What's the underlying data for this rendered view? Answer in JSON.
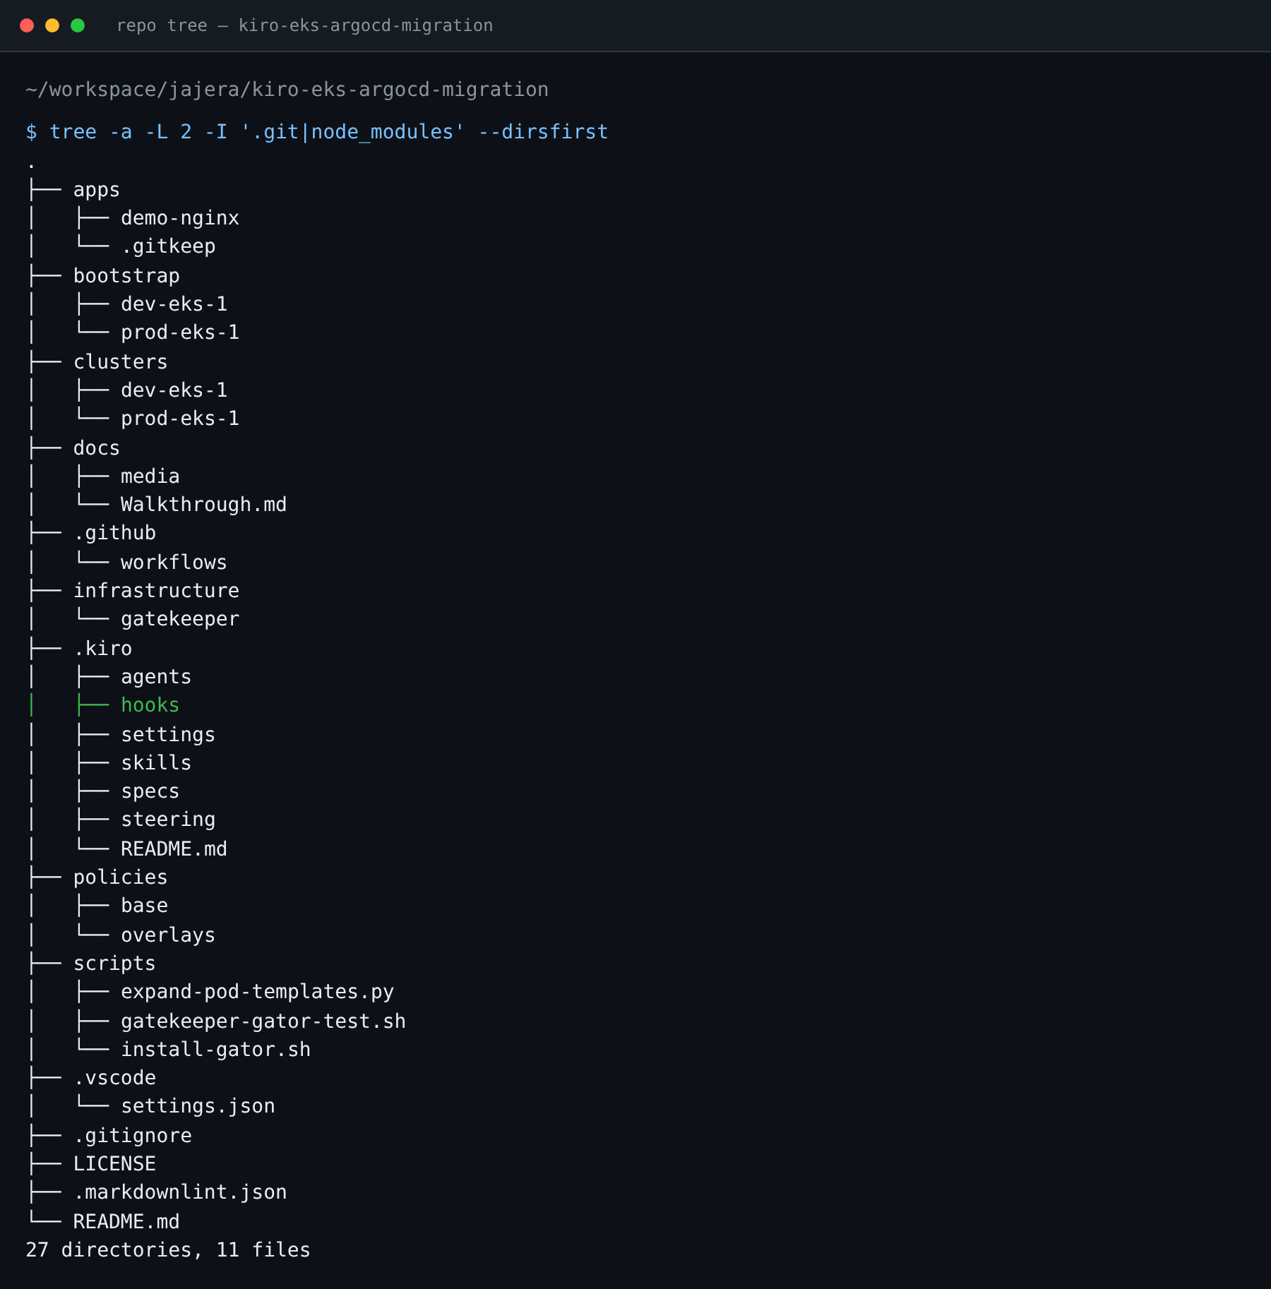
{
  "window": {
    "title": "repo tree — kiro-eks-argocd-migration"
  },
  "terminal": {
    "cwd": "~/workspace/jajera/kiro-eks-argocd-migration",
    "command": "$ tree -a -L 2 -I '.git|node_modules' --dirsfirst",
    "root": ".",
    "tree": [
      {
        "branch": "├── ",
        "name": "apps",
        "selected": false,
        "children": [
          {
            "branch": "│   ├── ",
            "name": "demo-nginx",
            "selected": false
          },
          {
            "branch": "│   └── ",
            "name": ".gitkeep",
            "selected": false
          }
        ]
      },
      {
        "branch": "├── ",
        "name": "bootstrap",
        "selected": false,
        "children": [
          {
            "branch": "│   ├── ",
            "name": "dev-eks-1",
            "selected": false
          },
          {
            "branch": "│   └── ",
            "name": "prod-eks-1",
            "selected": false
          }
        ]
      },
      {
        "branch": "├── ",
        "name": "clusters",
        "selected": false,
        "children": [
          {
            "branch": "│   ├── ",
            "name": "dev-eks-1",
            "selected": false
          },
          {
            "branch": "│   └── ",
            "name": "prod-eks-1",
            "selected": false
          }
        ]
      },
      {
        "branch": "├── ",
        "name": "docs",
        "selected": false,
        "children": [
          {
            "branch": "│   ├── ",
            "name": "media",
            "selected": false
          },
          {
            "branch": "│   └── ",
            "name": "Walkthrough.md",
            "selected": false
          }
        ]
      },
      {
        "branch": "├── ",
        "name": ".github",
        "selected": false,
        "children": [
          {
            "branch": "│   └── ",
            "name": "workflows",
            "selected": false
          }
        ]
      },
      {
        "branch": "├── ",
        "name": "infrastructure",
        "selected": false,
        "children": [
          {
            "branch": "│   └── ",
            "name": "gatekeeper",
            "selected": false
          }
        ]
      },
      {
        "branch": "├── ",
        "name": ".kiro",
        "selected": false,
        "children": [
          {
            "branch": "│   ├── ",
            "name": "agents",
            "selected": false
          },
          {
            "branch": "│   ├── ",
            "name": "hooks",
            "selected": true
          },
          {
            "branch": "│   ├── ",
            "name": "settings",
            "selected": false
          },
          {
            "branch": "│   ├── ",
            "name": "skills",
            "selected": false
          },
          {
            "branch": "│   ├── ",
            "name": "specs",
            "selected": false
          },
          {
            "branch": "│   ├── ",
            "name": "steering",
            "selected": false
          },
          {
            "branch": "│   └── ",
            "name": "README.md",
            "selected": false
          }
        ]
      },
      {
        "branch": "├── ",
        "name": "policies",
        "selected": false,
        "children": [
          {
            "branch": "│   ├── ",
            "name": "base",
            "selected": false
          },
          {
            "branch": "│   └── ",
            "name": "overlays",
            "selected": false
          }
        ]
      },
      {
        "branch": "├── ",
        "name": "scripts",
        "selected": false,
        "children": [
          {
            "branch": "│   ├── ",
            "name": "expand-pod-templates.py",
            "selected": false
          },
          {
            "branch": "│   ├── ",
            "name": "gatekeeper-gator-test.sh",
            "selected": false
          },
          {
            "branch": "│   └── ",
            "name": "install-gator.sh",
            "selected": false
          }
        ]
      },
      {
        "branch": "├── ",
        "name": ".vscode",
        "selected": false,
        "children": [
          {
            "branch": "│   └── ",
            "name": "settings.json",
            "selected": false
          }
        ]
      },
      {
        "branch": "├── ",
        "name": ".gitignore",
        "selected": false
      },
      {
        "branch": "├── ",
        "name": "LICENSE",
        "selected": false
      },
      {
        "branch": "├── ",
        "name": ".markdownlint.json",
        "selected": false
      },
      {
        "branch": "└── ",
        "name": "README.md",
        "selected": false
      }
    ],
    "summary": "27 directories, 11 files"
  }
}
